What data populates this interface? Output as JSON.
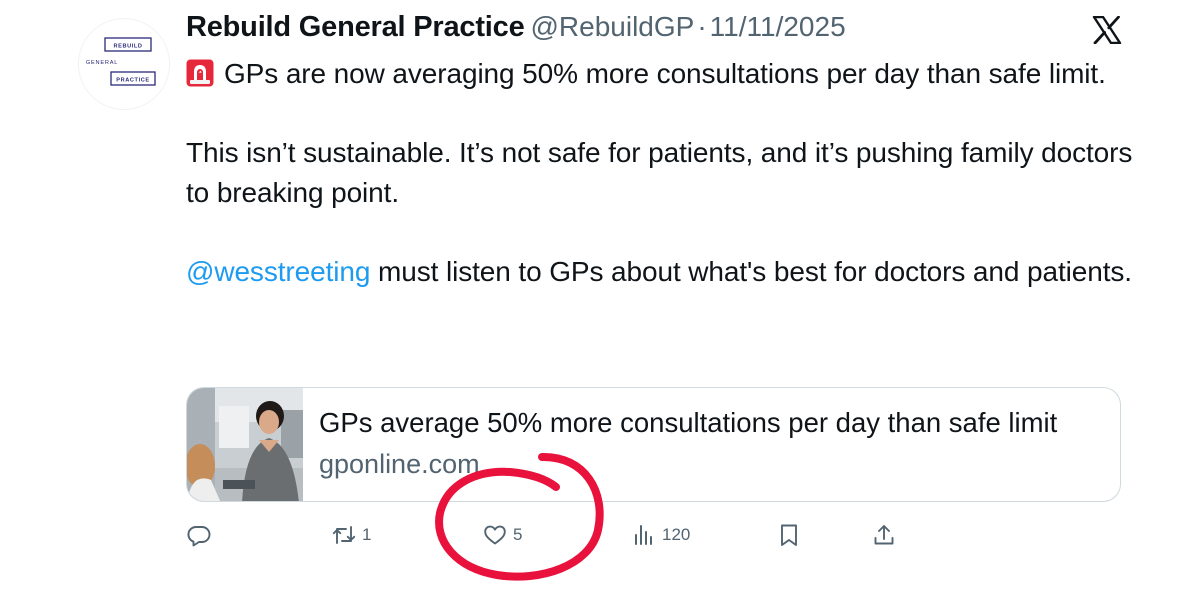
{
  "avatar": {
    "logo_words": [
      "REBUILD",
      "GENERAL",
      "PRACTICE"
    ]
  },
  "header": {
    "display_name": "Rebuild General Practice",
    "handle": "@RebuildGP",
    "separator": "·",
    "date": "11/11/2025",
    "platform_icon": "x-logo-icon"
  },
  "tweet": {
    "emoji_icon": "police-siren-icon",
    "paragraph_1": "GPs are now averaging 50% more consultations per day than safe limit.",
    "paragraph_2": "This isn’t sustainable. It’s not safe for patients, and it’s pushing family doctors to breaking point.",
    "mention": "@wesstreeting",
    "paragraph_3_rest": " must listen to GPs about what's best for doctors and patients."
  },
  "link_card": {
    "title": "GPs average 50% more consultations per day than safe limit",
    "domain": "gponline.com"
  },
  "actions": {
    "reply_icon": "reply-icon",
    "repost_icon": "repost-icon",
    "repost_count": "1",
    "like_icon": "heart-icon",
    "like_count": "5",
    "views_icon": "views-icon",
    "views_count": "120",
    "bookmark_icon": "bookmark-icon",
    "share_icon": "share-icon"
  },
  "colors": {
    "text": "#0f1419",
    "secondary": "#536471",
    "link": "#1d9bf0",
    "annotation": "#e8123c",
    "card_border": "#cfd9de",
    "logo_navy": "#2a2a7a"
  }
}
